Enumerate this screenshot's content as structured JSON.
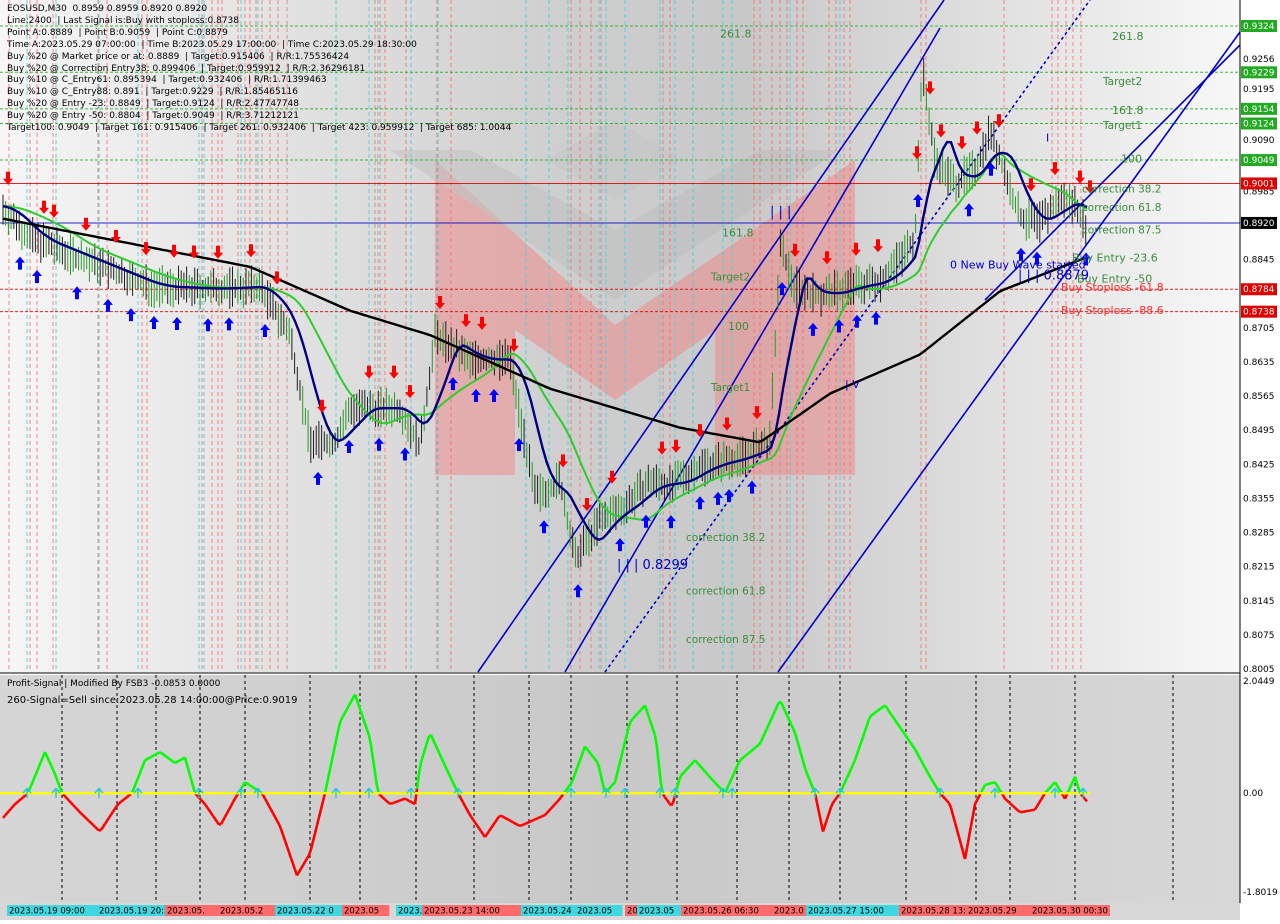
{
  "header": {
    "lines": [
      "EOSUSD,M30  0.8959 0.8959 0.8920 0.8920",
      "Line:2400  | Last Signal is:Buy with stoploss:0.8738",
      "Point A:0.8889  | Point B:0.9059  | Point C:0.8879",
      "Time A:2023.05.29 07:00:00  | Time B:2023.05.29 17:00:00  | Time C:2023.05.29 18:30:00",
      "Buy %20 @ Market price or at: 0.8889  | Target:0.915406  | R/R:1.75536424",
      "Buy %20 @ Correction Entry38: 0.899406  | Target:0.959912  | R/R:2.36296181",
      "Buy %10 @ C_Entry61: 0.895394  | Target:0.932406  | R/R:1.71399463",
      "Buy %10 @ C_Entry88: 0.891  | Target:0.9229  | R/R:1.85465116",
      "Buy %20 @ Entry -23: 0.8849  | Target:0.9124  | R/R:2.47747748",
      "Buy %20 @ Entry -50: 0.8804  | Target:0.9049  | R/R:3.71212121",
      "Target100: 0.9049  | Target 161: 0.915406  | Target 261: 0.932406  | Target 423: 0.959912  | Target 685: 1.0044"
    ]
  },
  "colors": {
    "up_arrow": "#0000ff",
    "down_arrow": "#ff0000",
    "label_green": "#3c8c3c",
    "label_red": "#ff2a2a",
    "channel": "#0000cc",
    "ma_green": "#2ecc2e",
    "ma_navy": "#000080",
    "ma_black": "#000000",
    "signal_zero": "#ffff00",
    "osc_up": "#00ff00",
    "osc_down": "#ff0000"
  },
  "chart_data": {
    "type": "candlestick",
    "symbol": "EOSUSD,M30",
    "ylim": [
      0.8005,
      0.9324
    ],
    "y_ticks": [
      "0.9324",
      "0.9256",
      "0.9195",
      "0.9124",
      "0.9090",
      "0.9049",
      "0.8985",
      "0.8920",
      "0.8845",
      "0.8784",
      "0.8738",
      "0.8705",
      "0.8635",
      "0.8565",
      "0.8495",
      "0.8425",
      "0.8355",
      "0.8285",
      "0.8215",
      "0.8145",
      "0.8075",
      "0.8005"
    ],
    "price_levels": [
      {
        "value": 0.9324,
        "label": "0.9324",
        "color": "#22aa22"
      },
      {
        "value": 0.9229,
        "label": "0.9229",
        "color": "#22aa22"
      },
      {
        "value": 0.9154,
        "label": "0.9154",
        "color": "#22aa22"
      },
      {
        "value": 0.9124,
        "label": "0.9124",
        "color": "#22aa22"
      },
      {
        "value": 0.9049,
        "label": "0.9049",
        "color": "#22aa22"
      },
      {
        "value": 0.9001,
        "label": "0.9001",
        "color": "#dd0000"
      },
      {
        "value": 0.892,
        "label": "0.8920",
        "color": "#000000"
      },
      {
        "value": 0.8784,
        "label": "0.8784",
        "color": "#dd0000"
      },
      {
        "value": 0.8738,
        "label": "0.8738",
        "color": "#dd0000"
      }
    ],
    "annotations": [
      {
        "text": "261.8",
        "x": 0.8,
        "y": 0.9303,
        "color": "green"
      },
      {
        "text": "261.8",
        "x": 0.7,
        "y": 0.9309,
        "color": "green"
      },
      {
        "text": "Target2",
        "x": 0.8,
        "y": 0.9211,
        "color": "green"
      },
      {
        "text": "161.8",
        "x": 0.8,
        "y": 0.9152,
        "color": "green"
      },
      {
        "text": "Target1",
        "x": 0.8,
        "y": 0.9121,
        "color": "green"
      },
      {
        "text": "100",
        "x": 0.8,
        "y": 0.9052,
        "color": "green"
      },
      {
        "text": "correction 38.2",
        "x": 0.8,
        "y": 0.8991,
        "color": "green"
      },
      {
        "text": "correction 61.8",
        "x": 0.8,
        "y": 0.8953,
        "color": "green"
      },
      {
        "text": "correction 87.5",
        "x": 0.8,
        "y": 0.8907,
        "color": "green"
      },
      {
        "text": "161.8",
        "x": 0.7,
        "y": 0.89,
        "color": "green"
      },
      {
        "text": "Target2",
        "x": 0.7,
        "y": 0.881,
        "color": "green"
      },
      {
        "text": "100",
        "x": 0.7,
        "y": 0.8709,
        "color": "green"
      },
      {
        "text": "Target1",
        "x": 0.7,
        "y": 0.8583,
        "color": "green"
      },
      {
        "text": "correction 38.2",
        "x": 0.7,
        "y": 0.8276,
        "color": "green"
      },
      {
        "text": "correction 61.8",
        "x": 0.7,
        "y": 0.8166,
        "color": "green"
      },
      {
        "text": "correction 87.5",
        "x": 0.7,
        "y": 0.8067,
        "color": "green"
      },
      {
        "text": "Buy Entry -23.6",
        "x": 0.8,
        "y": 0.8849,
        "color": "green"
      },
      {
        "text": "Buy Entry -50",
        "x": 0.8,
        "y": 0.8806,
        "color": "green"
      },
      {
        "text": "Buy Stoploss -61.8",
        "x": 0.8,
        "y": 0.8789,
        "color": "red"
      },
      {
        "text": "Buy Stoploss -88.6",
        "x": 0.8,
        "y": 0.8741,
        "color": "red"
      },
      {
        "text": "0 New Buy Wave started",
        "x": 0.8,
        "y": 0.8835,
        "color": "blue"
      },
      {
        "text": "| | | 0.8879",
        "x": 0.8,
        "y": 0.8812,
        "color": "blue"
      },
      {
        "text": "| | | 0.8299",
        "x": 0.7,
        "y": 0.8218,
        "color": "blue"
      },
      {
        "text": "| V",
        "x": 0.8,
        "y": 0.859,
        "color": "blue"
      },
      {
        "text": "| | |",
        "x": 0.7,
        "y": 0.8942,
        "color": "blue"
      },
      {
        "text": "V",
        "x": 0.8,
        "y": 0.9392,
        "color": "blue"
      },
      {
        "text": "I",
        "x": 0.8,
        "y": 0.9095,
        "color": "blue"
      }
    ],
    "time_labels": [
      "2023.05.19 09:00",
      "2023.05.19 20:30",
      "2023.05.",
      "2023.05.2",
      "2023.05.22 0",
      "2023.05",
      "2023.05",
      "2023.05.23 14:00",
      "2023.05.24",
      "2023.05",
      "2023.05.2",
      "2023.05",
      "2023.05.26 06:30",
      "2023.0",
      "2023.05.27 15:00",
      "2023.05.28 13:3",
      "2023.05.29",
      "2023.05.30 00:30"
    ]
  },
  "indicator": {
    "name": "Profit-Signal | Modified By FSB3 -0.0853 0.0000",
    "status": "260-Signal=Sell since:2023.05.28 14:00:00@Price:0.9019",
    "ylim": [
      -1.8019,
      2.0449
    ],
    "y_ticks": [
      "2.0449",
      "0.00",
      "-1.8019"
    ]
  }
}
